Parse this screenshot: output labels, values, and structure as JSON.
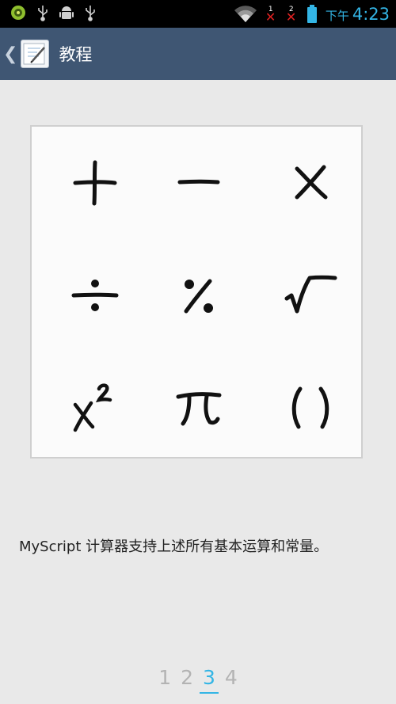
{
  "status_bar": {
    "ampm": "下午",
    "time": "4:23",
    "sim1": "1",
    "sim2": "2",
    "icons": [
      "app-notification-icon",
      "usb-icon",
      "android-debug-icon",
      "usb-icon",
      "wifi-icon",
      "no-signal-icon",
      "battery-icon"
    ]
  },
  "action_bar": {
    "title": "教程",
    "back_glyph": "❮"
  },
  "symbols": [
    "plus-symbol",
    "minus-symbol",
    "times-symbol",
    "divide-symbol",
    "percent-symbol",
    "sqrt-symbol",
    "x-squared-symbol",
    "pi-symbol",
    "parentheses-symbol"
  ],
  "description": "MyScript 计算器支持上述所有基本运算和常量。",
  "pager": {
    "pages": [
      "1",
      "2",
      "3",
      "4"
    ],
    "active_index": 2
  },
  "colors": {
    "action_bar": "#3f5673",
    "accent": "#33b5e5",
    "background": "#e9e9e9"
  }
}
